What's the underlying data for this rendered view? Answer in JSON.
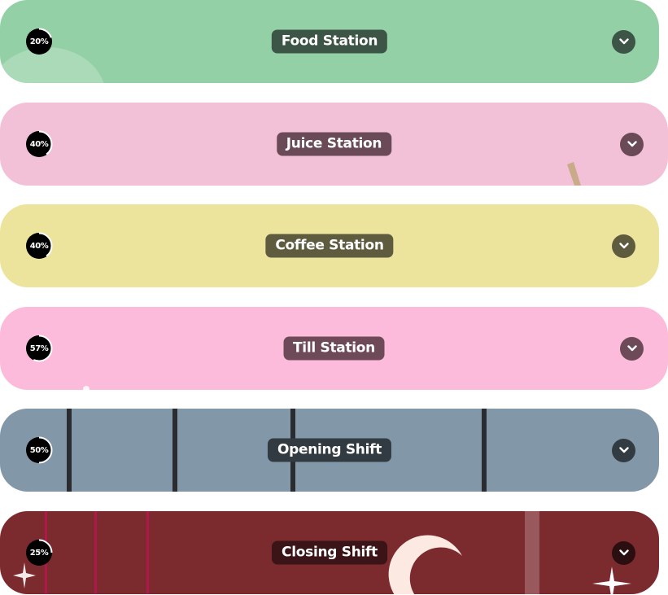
{
  "stations": [
    {
      "title": "Food Station",
      "progress_label": "20%",
      "progress": 0.2,
      "bg": "#94d0a6",
      "pill": "#3c5546",
      "chevron": "#3c5546"
    },
    {
      "title": "Juice Station",
      "progress_label": "40%",
      "progress": 0.4,
      "bg": "#f2c1d8",
      "pill": "#6a4a57",
      "chevron": "#6a4a57"
    },
    {
      "title": "Coffee Station",
      "progress_label": "40%",
      "progress": 0.4,
      "bg": "#ece49d",
      "pill": "#5f5b3e",
      "chevron": "#5f5b3e"
    },
    {
      "title": "Till Station",
      "progress_label": "57%",
      "progress": 0.57,
      "bg": "#fcbbda",
      "pill": "#6e4a58",
      "chevron": "#6e4a58"
    },
    {
      "title": "Opening Shift",
      "progress_label": "50%",
      "progress": 0.5,
      "bg": "#8298a8",
      "pill": "#333b42",
      "chevron": "#333b42"
    },
    {
      "title": "Closing Shift",
      "progress_label": "25%",
      "progress": 0.25,
      "bg": "#7b2a2d",
      "pill": "#3a1416",
      "chevron": "#2b0e10"
    }
  ],
  "icons": {
    "chevron": "chevron-down-icon",
    "progress": "progress-ring-icon"
  }
}
